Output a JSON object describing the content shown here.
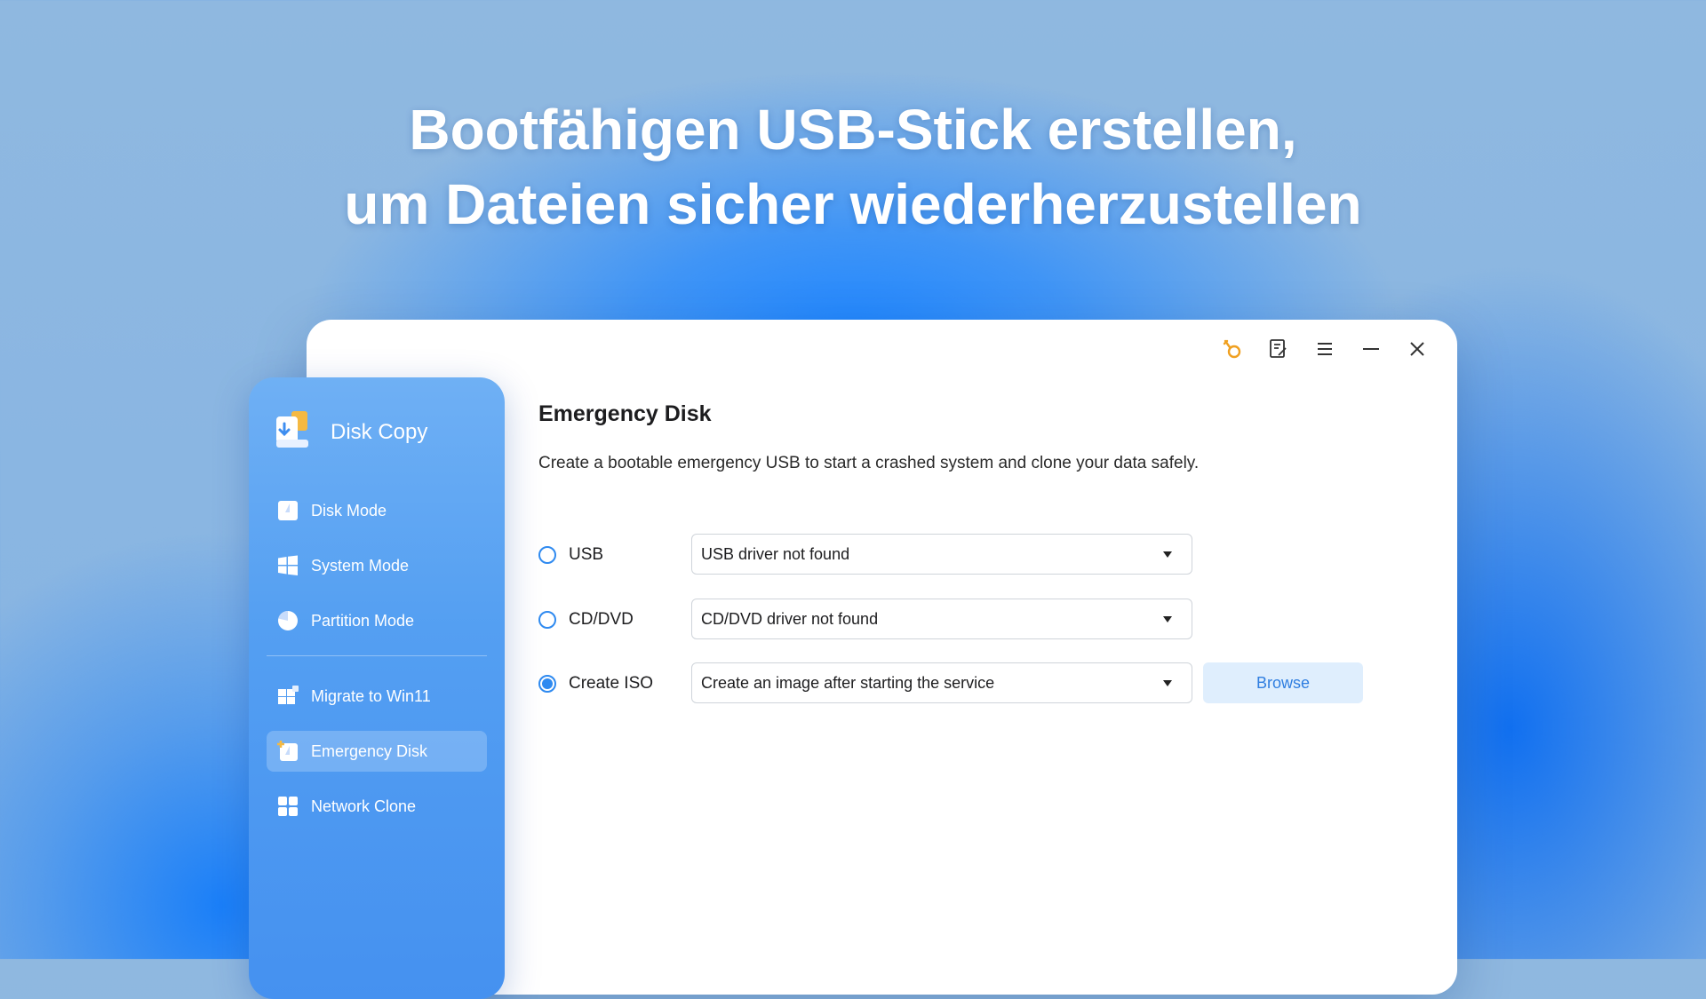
{
  "headline": {
    "line1": "Bootfähigen USB-Stick erstellen,",
    "line2": "um Dateien sicher wiederherzustellen"
  },
  "titlebar": {
    "icons": [
      "key-icon",
      "feedback-icon",
      "menu-icon",
      "minimize-icon",
      "close-icon"
    ],
    "key_color": "#f0a020"
  },
  "sidebar": {
    "brand_label": "Disk Copy",
    "items": [
      {
        "label": "Disk Mode",
        "icon": "disk-mode-icon"
      },
      {
        "label": "System Mode",
        "icon": "windows-icon"
      },
      {
        "label": "Partition Mode",
        "icon": "pie-chart-icon"
      },
      {
        "label": "Migrate to Win11",
        "icon": "win11-icon"
      },
      {
        "label": "Emergency Disk",
        "icon": "emergency-disk-icon",
        "active": true
      },
      {
        "label": "Network Clone",
        "icon": "grid-icon"
      }
    ]
  },
  "main": {
    "title": "Emergency Disk",
    "description": "Create a bootable emergency USB to start a crashed system and clone your data safely.",
    "options": [
      {
        "label": "USB",
        "selected": false,
        "dropdown_value": "USB driver not found"
      },
      {
        "label": "CD/DVD",
        "selected": false,
        "dropdown_value": "CD/DVD driver not found"
      },
      {
        "label": "Create ISO",
        "selected": true,
        "dropdown_value": "Create an image after starting the service"
      }
    ],
    "browse_label": "Browse"
  },
  "colors": {
    "accent": "#2f8af0",
    "sidebar": "#549ff2",
    "browse_bg": "#dfeefd"
  }
}
